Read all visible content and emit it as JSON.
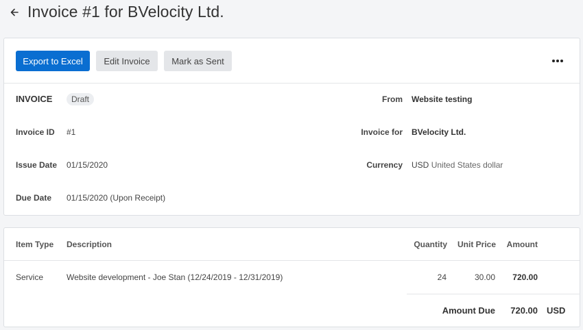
{
  "header": {
    "back_icon": "arrow-left-icon",
    "title": "Invoice #1 for BVelocity Ltd."
  },
  "toolbar": {
    "export_label": "Export to Excel",
    "edit_label": "Edit Invoice",
    "mark_sent_label": "Mark as Sent",
    "more_icon": "more-horizontal-icon",
    "primary_color": "#0a6ed1"
  },
  "invoice": {
    "heading": "INVOICE",
    "status": "Draft",
    "id_label": "Invoice ID",
    "id_value": "#1",
    "issue_label": "Issue Date",
    "issue_value": "01/15/2020",
    "due_label": "Due Date",
    "due_value": "01/15/2020 (Upon Receipt)",
    "from_label": "From",
    "from_value": "Website testing",
    "for_label": "Invoice for",
    "for_value": "BVelocity Ltd.",
    "currency_label": "Currency",
    "currency_code": "USD",
    "currency_name": "United States dollar"
  },
  "items": {
    "columns": {
      "type": "Item Type",
      "description": "Description",
      "quantity": "Quantity",
      "unit_price": "Unit Price",
      "amount": "Amount"
    },
    "rows": [
      {
        "type": "Service",
        "description": "Website development - Joe Stan (12/24/2019 - 12/31/2019)",
        "quantity": "24",
        "unit_price": "30.00",
        "amount": "720.00"
      }
    ],
    "total_label": "Amount Due",
    "total_value": "720.00",
    "total_currency": "USD"
  }
}
